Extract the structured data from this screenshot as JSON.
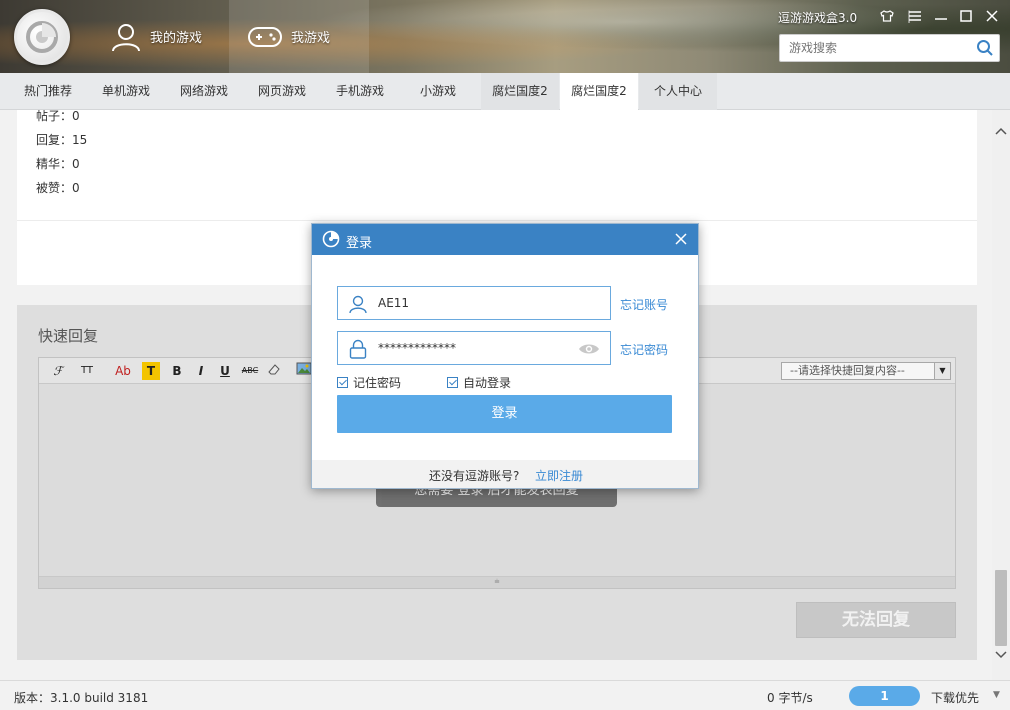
{
  "header": {
    "app_title": "逗游游戏盒3.0",
    "my_games": "我的游戏",
    "find_games": "我游戏",
    "search_placeholder": "游戏搜索"
  },
  "categories": [
    {
      "label": "热门推荐"
    },
    {
      "label": "单机游戏"
    },
    {
      "label": "网络游戏"
    },
    {
      "label": "网页游戏"
    },
    {
      "label": "手机游戏"
    },
    {
      "label": "小游戏"
    },
    {
      "label": "腐烂国度2"
    },
    {
      "label": "腐烂国度2"
    },
    {
      "label": "个人中心"
    }
  ],
  "stats": {
    "posts": "帖子：0",
    "replies": "回复：15",
    "essence": "精华：0",
    "likes": "被赞：0"
  },
  "reply": {
    "title": "快速回复",
    "quick_select": "--请选择快捷回复内容--",
    "toast": "您需要 登录 后才能发表回复",
    "submit": "无法回复"
  },
  "toolbar": {
    "font": "ℱ",
    "size": "TT",
    "color": "Ab",
    "bg": "T",
    "bold": "B",
    "italic": "I",
    "underline": "U",
    "strike": "ABC"
  },
  "status": {
    "version": "版本：3.1.0 build 3181",
    "speed": "0 字节/s",
    "download_count": "1",
    "priority": "下载优先"
  },
  "login": {
    "title": "登录",
    "username": "AE11",
    "password": "*************",
    "forgot_account": "忘记账号",
    "forgot_password": "忘记密码",
    "remember": "记住密码",
    "auto_login": "自动登录",
    "login_button": "登录",
    "no_account": "还没有逗游账号?",
    "register": "立即注册"
  },
  "colors": {
    "accent": "#3a82c4",
    "button": "#5aaae8",
    "link": "#3a8ad4"
  }
}
